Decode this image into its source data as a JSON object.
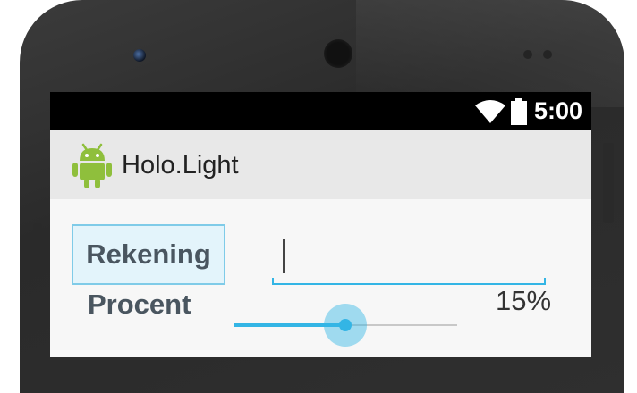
{
  "status_bar": {
    "time": "5:00",
    "icons": [
      "wifi-icon",
      "battery-icon"
    ]
  },
  "action_bar": {
    "app_icon": "android-icon",
    "title": "Holo.Light"
  },
  "form": {
    "rekening_button_label": "Rekening",
    "amount_input_value": "",
    "procent_label": "Procent",
    "percent_value": "15%",
    "slider_level": 0.5
  },
  "colors": {
    "accent": "#33b5e5",
    "status_bar": "#000000",
    "action_bar": "#e8e8e8",
    "label_text": "#4a5660"
  }
}
